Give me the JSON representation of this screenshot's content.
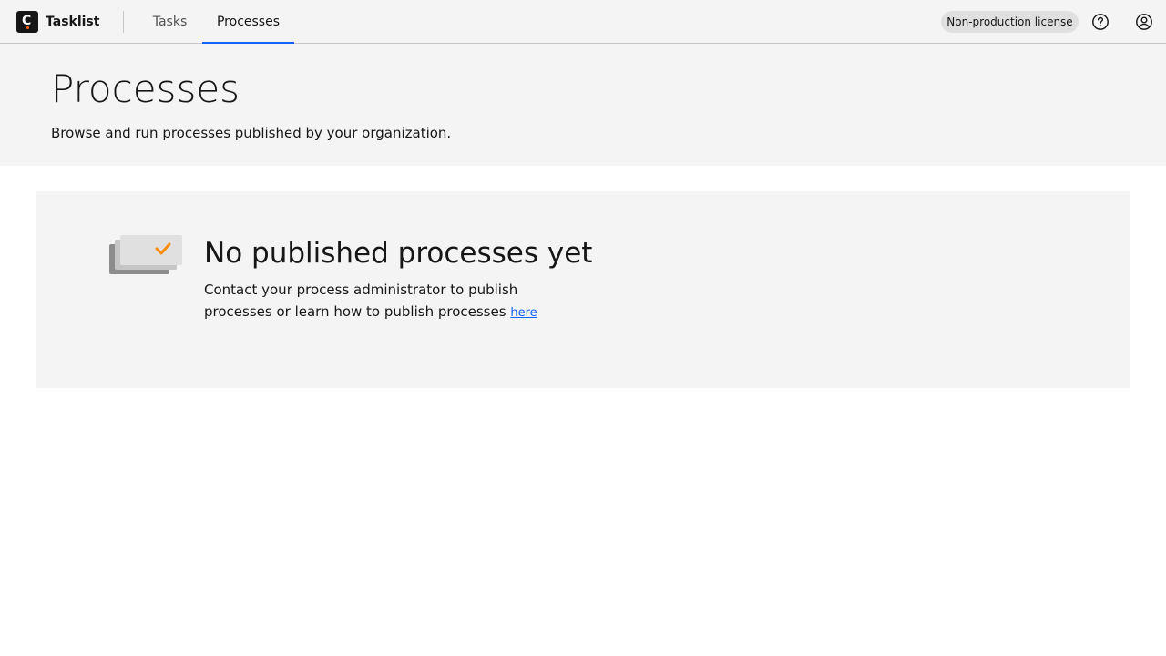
{
  "header": {
    "app_name": "Tasklist",
    "nav": [
      {
        "label": "Tasks",
        "active": false
      },
      {
        "label": "Processes",
        "active": true
      }
    ],
    "license_tag": "Non-production license",
    "icons": {
      "help": "help-icon",
      "user": "user-avatar-icon"
    }
  },
  "page": {
    "title": "Processes",
    "subtitle": "Browse and run processes published by your organization."
  },
  "empty_state": {
    "illustration": "empty-processes-icon",
    "title": "No published processes yet",
    "description": "Contact your process administrator to publish processes or learn how to publish processes",
    "link_label": "here"
  },
  "colors": {
    "accent": "#0f62fe",
    "brand": "#fc5d0d",
    "checkmark": "#fc8c00",
    "header_bg": "#f4f4f4"
  }
}
